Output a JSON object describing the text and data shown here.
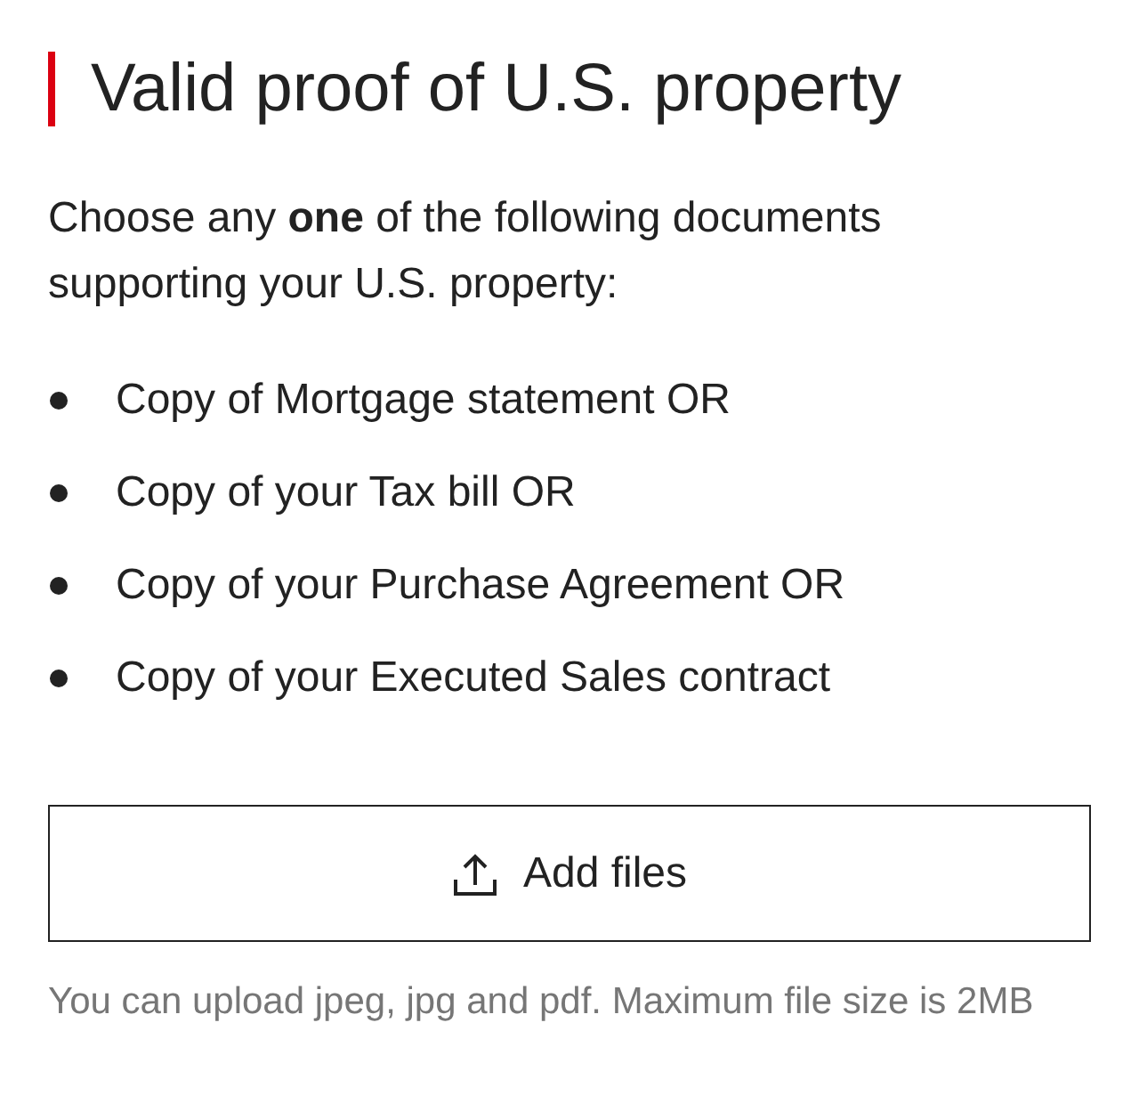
{
  "title": "Valid proof of U.S. property",
  "intro": "Choose any **one** of the following documents supporting your U.S. property:",
  "documents": [
    "Copy of Mortgage statement OR",
    "Copy of your Tax bill OR",
    "Copy of your Purchase Agreement OR",
    "Copy of your Executed Sales contract"
  ],
  "upload_button": {
    "label": "Add files"
  },
  "hint": "You can upload jpeg, jpg and pdf. Maximum file size is 2MB"
}
